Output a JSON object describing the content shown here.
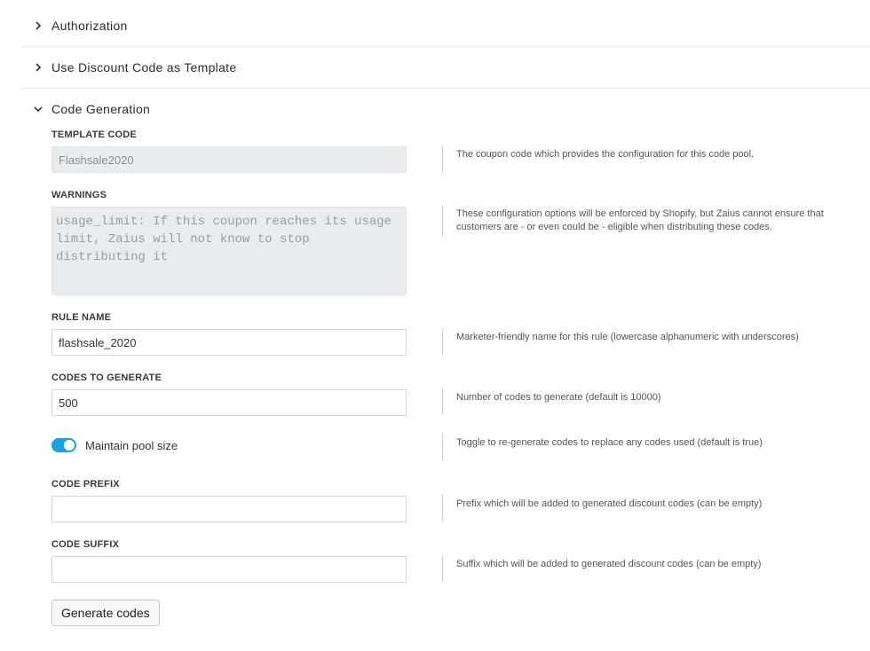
{
  "sections": [
    {
      "title": "Authorization",
      "expanded": false
    },
    {
      "title": "Use Discount Code as Template",
      "expanded": false
    },
    {
      "title": "Code Generation",
      "expanded": true
    }
  ],
  "form": {
    "template_code": {
      "label": "TEMPLATE CODE",
      "value": "Flashsale2020",
      "help": "The coupon code which provides the configuration for this code pool."
    },
    "warnings": {
      "label": "WARNINGS",
      "value": "usage_limit: If this coupon reaches its usage limit, Zaius will not know to stop distributing it",
      "help": "These configuration options will be enforced by Shopify, but Zaius cannot ensure that customers are - or even could be - eligible when distributing these codes."
    },
    "rule_name": {
      "label": "RULE NAME",
      "value": "flashsale_2020",
      "help": "Marketer-friendly name for this rule (lowercase alphanumeric with underscores)"
    },
    "codes_to_generate": {
      "label": "CODES TO GENERATE",
      "value": "500",
      "help": "Number of codes to generate (default is 10000)"
    },
    "maintain_pool": {
      "label": "Maintain pool size",
      "checked": true,
      "help": "Toggle to re-generate codes to replace any codes used (default is true)"
    },
    "code_prefix": {
      "label": "CODE PREFIX",
      "value": "",
      "help": "Prefix which will be added to generated discount codes (can be empty)"
    },
    "code_suffix": {
      "label": "CODE SUFFIX",
      "value": "",
      "help": "Suffix which will be added to generated discount codes (can be empty)"
    }
  },
  "generate_button": "Generate codes",
  "colors": {
    "toggle_on": "#1aa1dd",
    "disabled_bg": "#e9ecef"
  },
  "icons": {
    "collapsed": "chevron-right-icon",
    "expanded": "chevron-down-icon"
  }
}
